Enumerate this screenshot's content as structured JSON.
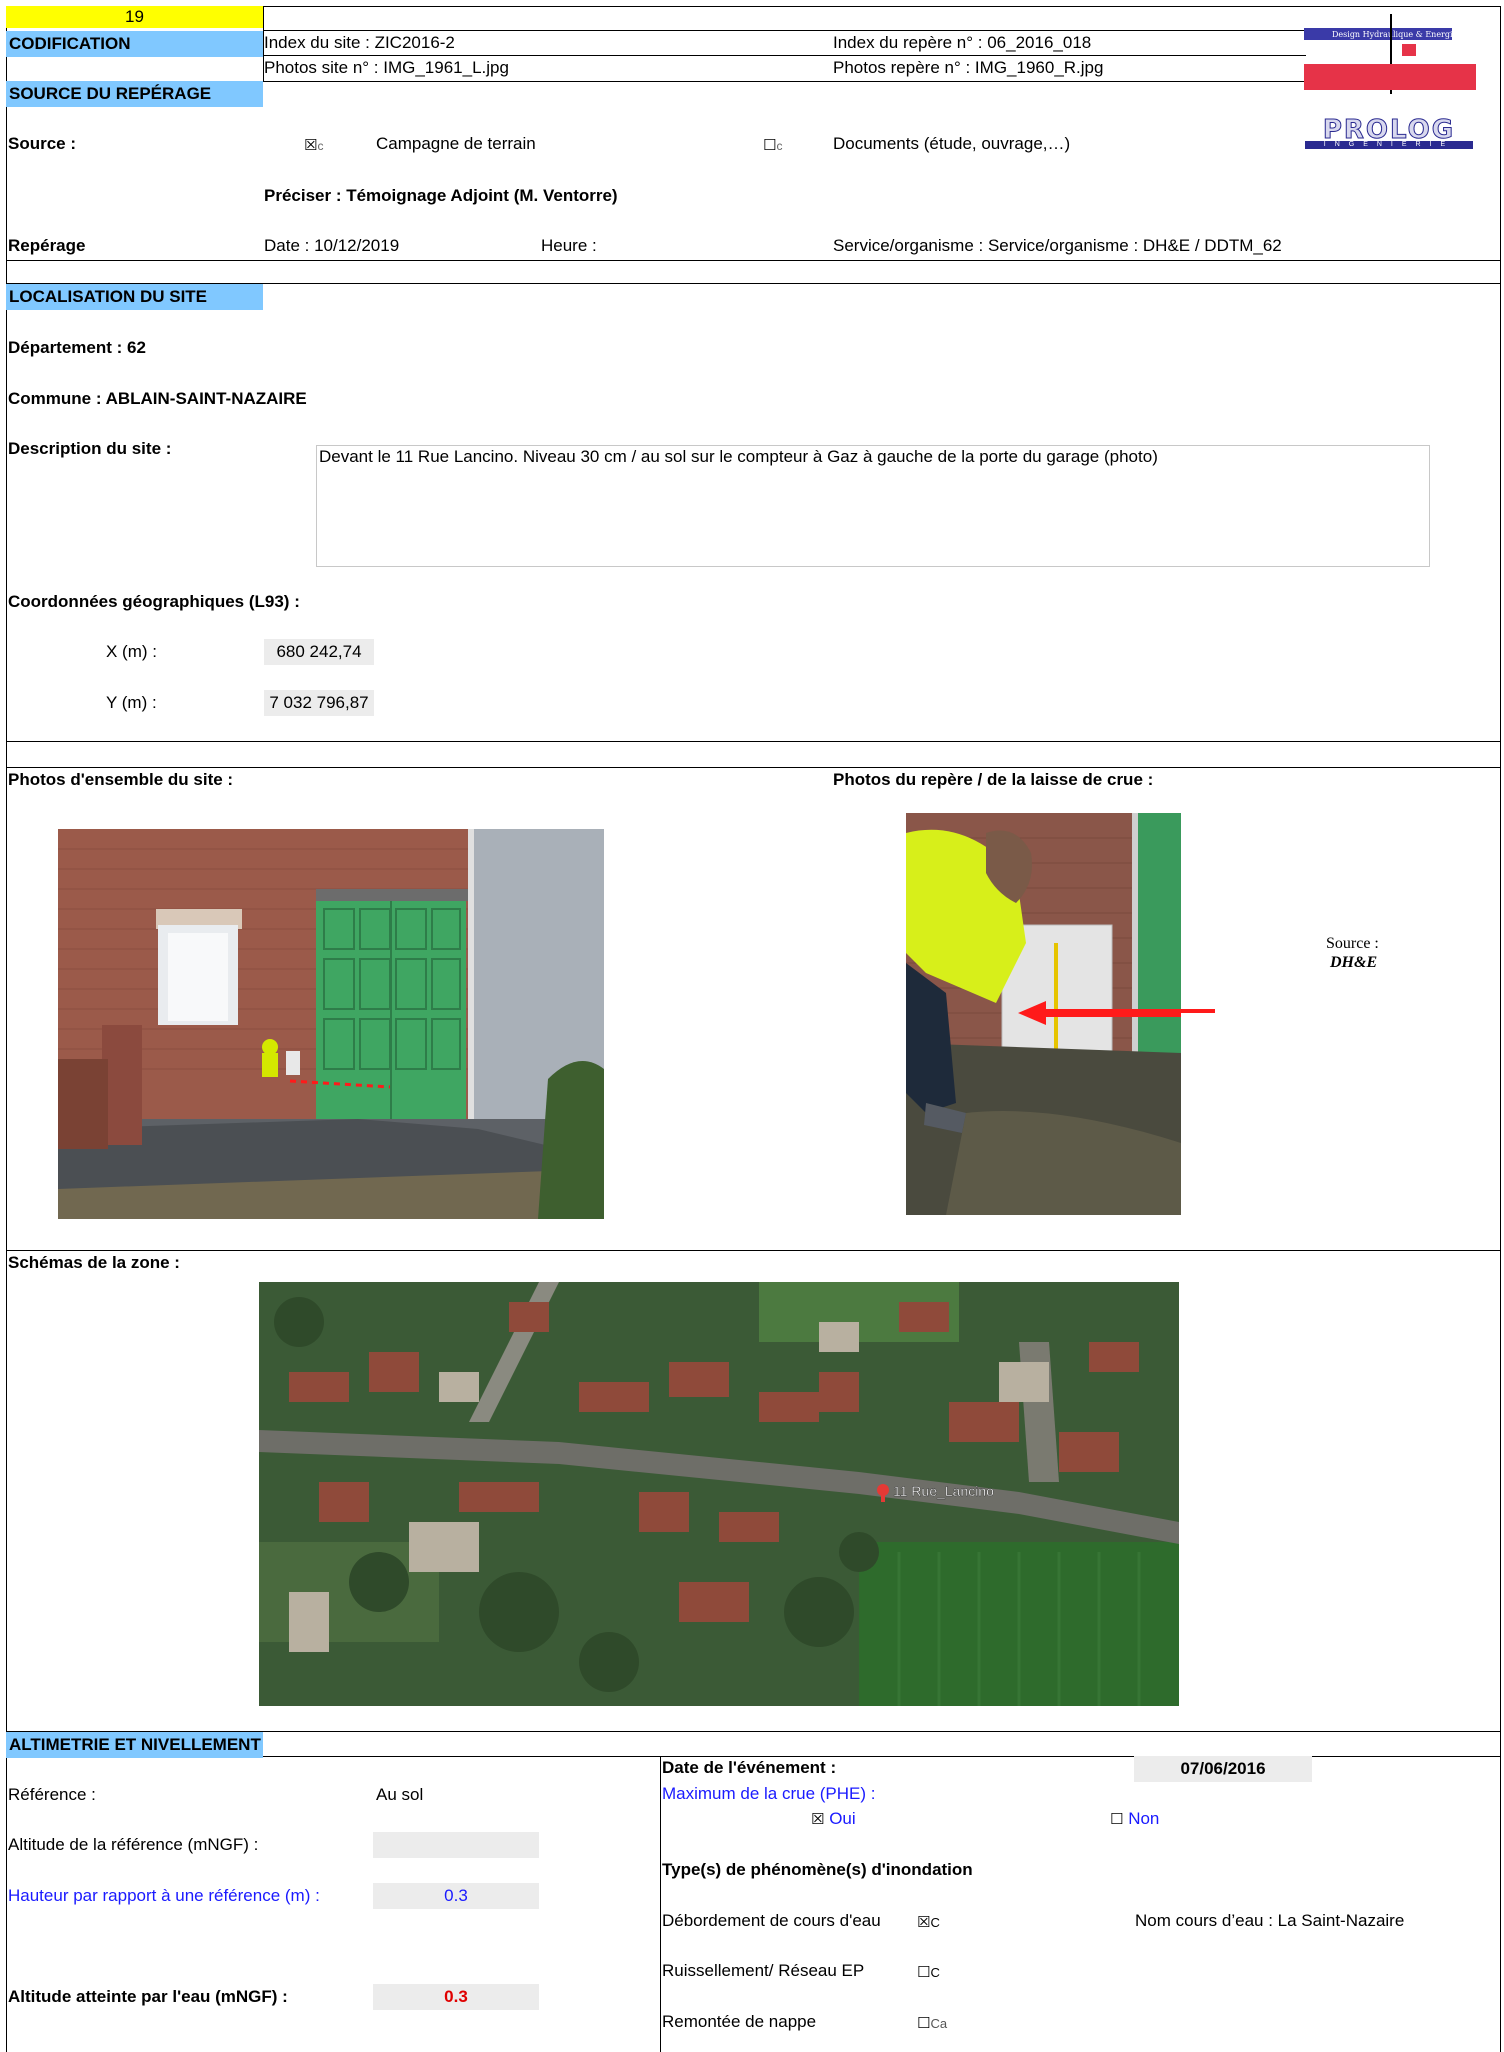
{
  "header": {
    "number": "19",
    "codification_label": "CODIFICATION",
    "site_index": "Index du site : ZIC2016-2",
    "repere_index": "Index du repère n° : 06_2016_018",
    "photos_site": "Photos site n° :  IMG_1961_L.jpg",
    "photos_repere": "Photos repère n° : IMG_1960_R.jpg",
    "logo_dhe_text": "Design Hydraulique & Energie",
    "logo_prolog_text": "PROLOG",
    "logo_prolog_sub": "INGENIERIE"
  },
  "source": {
    "section_title": "SOURCE DU REPÉRAGE",
    "label": "Source :",
    "option1_box": "☒",
    "option1_suffix": "c",
    "option1_label": "Campagne de terrain",
    "option2_box": "☐",
    "option2_suffix": "c",
    "option2_label": "Documents (étude, ouvrage,…)",
    "preciser": "Préciser : Témoignage Adjoint (M. Ventorre)",
    "reperage_label": "Repérage",
    "date": "Date : 10/12/2019",
    "heure": "Heure :",
    "service": "Service/organisme : Service/organisme : DH&E / DDTM_62"
  },
  "localisation": {
    "section_title": "LOCALISATION DU SITE",
    "departement": "Département :  62",
    "commune": "Commune :  ABLAIN-SAINT-NAZAIRE",
    "description_label": "Description du site :",
    "description_text": "Devant le 11 Rue Lancino.  Niveau 30 cm / au sol sur le compteur à Gaz à gauche de la porte du garage (photo)",
    "coords_label": "Coordonnées géographiques (L93) :",
    "x_label": "X (m) :",
    "x_value": "680 242,74",
    "y_label": "Y (m) :",
    "y_value": "7 032 796,87"
  },
  "photos": {
    "ensemble_label": "Photos d'ensemble du site :",
    "repere_label": "Photos du repère / de la laisse de crue  :",
    "source_label": "Source :",
    "source_value": "DH&E",
    "schemas_label": "Schémas de la zone :",
    "map_pin_label": "11 Rue_Lancino"
  },
  "altimetrie": {
    "section_title": "ALTIMETRIE ET NIVELLEMENT",
    "reference_label": "Référence :",
    "reference_value": "Au sol",
    "altitude_ref_label": "Altitude de la référence (mNGF)  :",
    "altitude_ref_value": "",
    "hauteur_label": "Hauteur par rapport à une référence (m) :",
    "hauteur_value": "0.3",
    "altitude_eau_label": "Altitude atteinte par l'eau (mNGF) :",
    "altitude_eau_value": "0.3",
    "date_evenement_label": "Date de l'événement :",
    "date_evenement_value": "07/06/2016",
    "phe_label": "Maximum de la crue (PHE) :",
    "oui_box": "☒",
    "oui_label": "Oui",
    "non_box": "☐",
    "non_label": "Non",
    "types_label": "Type(s) de phénomène(s) d'inondation",
    "debordement_label": "Débordement de cours d'eau",
    "debordement_box": "☒",
    "debordement_suffix": "C",
    "nom_cours": "Nom cours d’eau : La Saint-Nazaire",
    "ruissellement_label": "Ruissellement/ Réseau EP",
    "ruissellement_box": "☐",
    "ruissellement_suffix": "C",
    "remontee_label": "Remontée de nappe",
    "remontee_box": "☐",
    "remontee_suffix": "Ca"
  }
}
